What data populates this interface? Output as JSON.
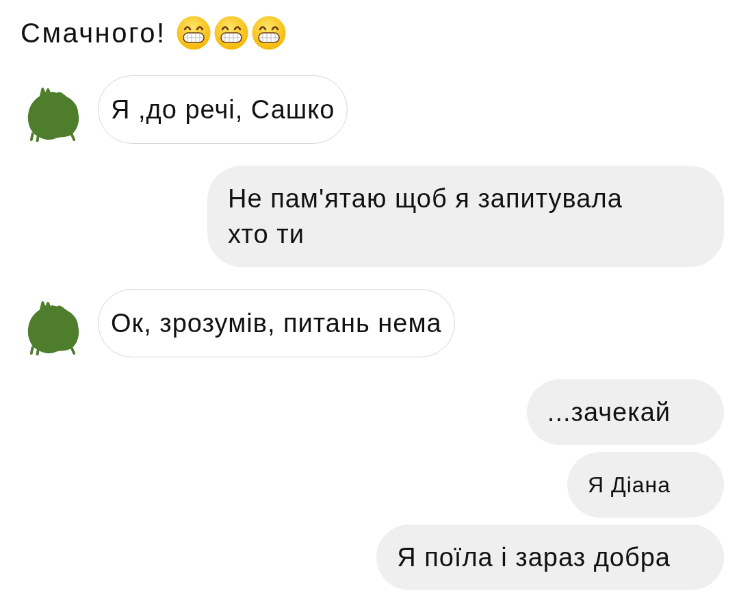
{
  "header": {
    "text": "Смачного!",
    "emojis": [
      {
        "kind": "grin"
      },
      {
        "kind": "grin"
      },
      {
        "kind": "grin"
      }
    ]
  },
  "messages": [
    {
      "kind": "incoming",
      "text": "Я ,до речі, Сашко"
    },
    {
      "kind": "outgoing",
      "text": "Не пам'ятаю щоб я запитувала хто ти"
    },
    {
      "kind": "incoming",
      "text": "Ок, зрозумів, питань нема"
    },
    {
      "kind": "outgoing",
      "text": "...зачекай"
    },
    {
      "kind": "outgoing",
      "text": "Я Діана"
    },
    {
      "kind": "outgoing",
      "text": "Я поїла і зараз добра"
    }
  ]
}
